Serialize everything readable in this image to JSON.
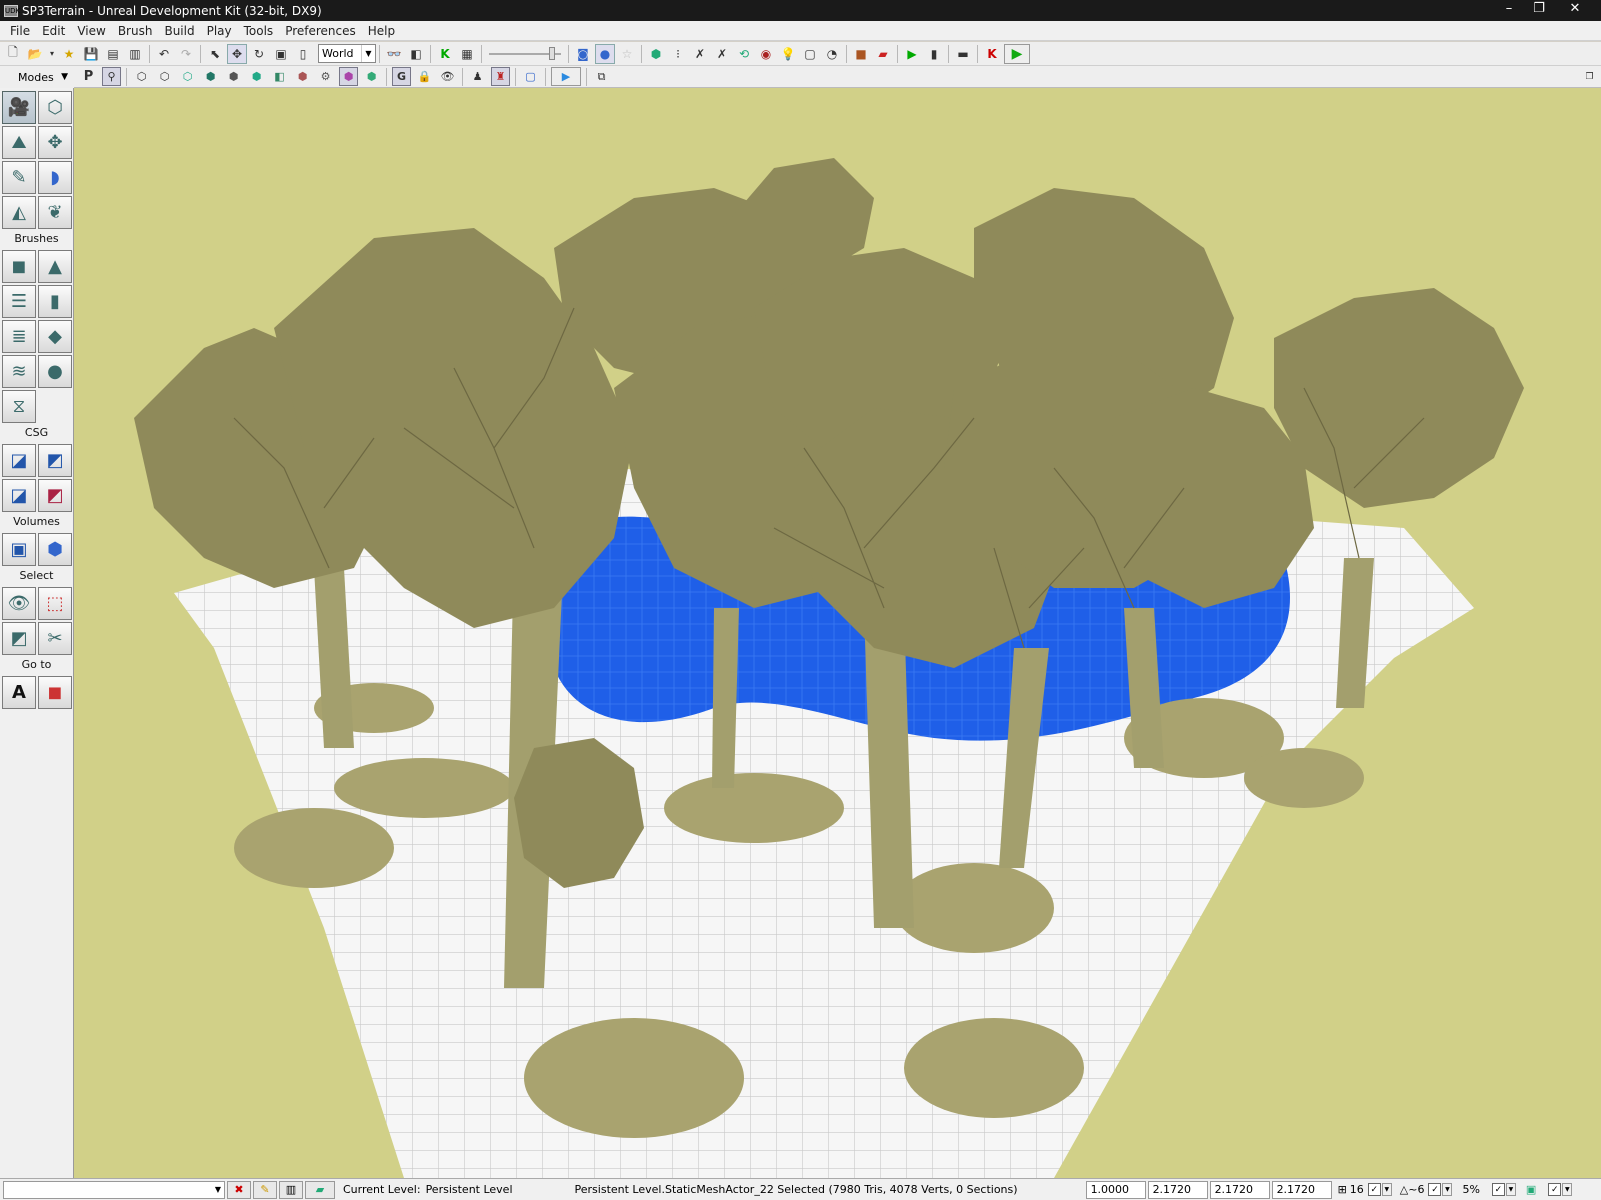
{
  "window": {
    "title": "SP3Terrain - Unreal Development Kit (32-bit, DX9)",
    "app_icon_text": "UDK",
    "minimize": "–",
    "restore": "❐",
    "close": "✕"
  },
  "menu": [
    "File",
    "Edit",
    "View",
    "Brush",
    "Build",
    "Play",
    "Tools",
    "Preferences",
    "Help"
  ],
  "toolbar": {
    "coord_system": "World"
  },
  "sidebar": {
    "modes_label": "Modes",
    "brushes_label": "Brushes",
    "csg_label": "CSG",
    "volumes_label": "Volumes",
    "select_label": "Select",
    "goto_label": "Go to"
  },
  "viewport": {
    "background_color": "#d1d088",
    "foliage_color": "#8f8a5a",
    "water_color": "#1f5fe8",
    "ground_color": "#f4f4f4"
  },
  "status": {
    "current_level_label": "Current Level:",
    "current_level_value": "Persistent Level",
    "selection_text": "Persistent Level.StaticMeshActor_22 Selected (7980 Tris, 4078 Verts, 0 Sections)",
    "drag_grid": "1.0000",
    "scale_x": "2.1720",
    "scale_y": "2.1720",
    "scale_z": "2.1720",
    "grid_size": "16",
    "rotation_snap": "~6",
    "scale_snap": "5%"
  }
}
